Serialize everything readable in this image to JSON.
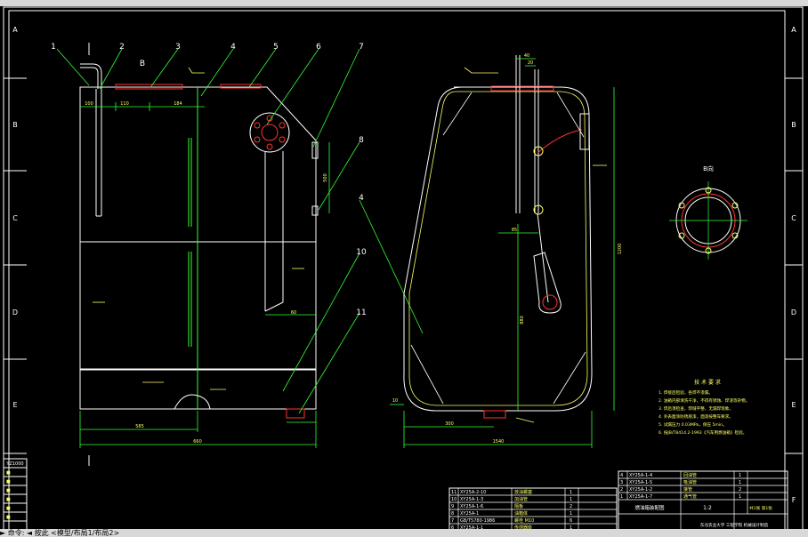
{
  "border": {
    "row_letters": [
      "A",
      "B",
      "C",
      "D",
      "E",
      "F"
    ]
  },
  "view_b_label": "B",
  "section_label": "B向",
  "part_callouts": [
    "1",
    "2",
    "3",
    "4",
    "5",
    "6",
    "7",
    "8",
    "4",
    "10",
    "11"
  ],
  "dims_front": {
    "d1": "100",
    "d2": "110",
    "d3": "184",
    "d4": "500",
    "d5": "60",
    "d6": "585",
    "d7": "660"
  },
  "dims_side": {
    "d1": "40",
    "d2": "20",
    "d3": "85",
    "d4": "1200",
    "d5": "880",
    "d6": "10",
    "d7": "300",
    "d8": "1540"
  },
  "tech_notes": {
    "title": "技 术 要 求",
    "lines": [
      "1. 焊接后检验，各焊不渗漏。",
      "2. 油箱内部清洗干净，不得有锈蚀、焊渣等杂物。",
      "3. 焊后须检查，焊缝平整、无漏焊现象。",
      "4. 外表面涂防锈底漆，面漆按整车要求。",
      "5. 试漏压力 0.03MPa，保压 5min。",
      "6. 按JB/T8414.2-1993《汽车用燃油箱》检验。"
    ]
  },
  "bom_left": [
    {
      "no": "11",
      "code": "XY25A-2-10",
      "name": "放油螺塞",
      "qty": "1"
    },
    {
      "no": "10",
      "code": "XY25A-1-3",
      "name": "加油管",
      "qty": "1"
    },
    {
      "no": "9",
      "code": "XY25A-1-6",
      "name": "隔板",
      "qty": "2"
    },
    {
      "no": "8",
      "code": "XY25A-1",
      "name": "油箱体",
      "qty": "1"
    },
    {
      "no": "7",
      "code": "GB/T5780-1986",
      "name": "螺栓 M10",
      "qty": "6"
    },
    {
      "no": "6",
      "code": "XY25A-1-1",
      "name": "传感器座",
      "qty": "1"
    }
  ],
  "bom_right": [
    {
      "no": "4",
      "code": "XY25A-1-4",
      "name": "回油管",
      "qty": "1"
    },
    {
      "no": "3",
      "code": "XY25A-1-5",
      "name": "吸油管",
      "qty": "1"
    },
    {
      "no": "2",
      "code": "XY25A-1-2",
      "name": "接管",
      "qty": "2"
    },
    {
      "no": "1",
      "code": "XY25A-1-7",
      "name": "通气管",
      "qty": "1"
    }
  ],
  "title_block": {
    "drawing_title": "燃油箱装配图",
    "scale": "1:2",
    "school": "东北农业大学 工程学院 机械设计制造",
    "sheet_label": "共1张 第1张"
  },
  "left_panel_title": "YZ1000",
  "bottom_status": "►  命令: ◄  按此  <模型/布局1/布局2>"
}
